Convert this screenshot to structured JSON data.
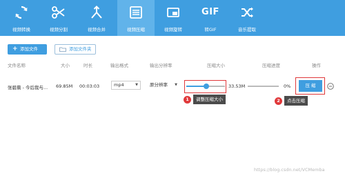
{
  "toolbar": {
    "items": [
      {
        "label": "视频转换",
        "icon": "convert-icon"
      },
      {
        "label": "视频分割",
        "icon": "scissors-icon"
      },
      {
        "label": "视频合并",
        "icon": "merge-icon"
      },
      {
        "label": "视频压缩",
        "icon": "compress-icon"
      },
      {
        "label": "视频旋转",
        "icon": "rotate-icon"
      },
      {
        "label": "转GIF",
        "icon": "gif-icon",
        "glyph": "GIF"
      },
      {
        "label": "音乐提取",
        "icon": "shuffle-icon"
      }
    ],
    "active_index": 3,
    "bg_color": "#3f9ee0"
  },
  "actions": {
    "add_file": "添加文件",
    "add_folder": "添加文件夹"
  },
  "table": {
    "headers": {
      "name": "文件名称",
      "size": "大小",
      "duration": "时长",
      "format": "输出格式",
      "resolution": "输出分辨率",
      "compress_size": "压缩大小",
      "progress": "压缩进度",
      "action": "操作"
    },
    "rows": [
      {
        "name": "张碧晨 - 今后我与...",
        "size": "69.85M",
        "duration": "00:03:03",
        "format": "mp4",
        "resolution": "原分辨率",
        "compress_slider_fraction": 0.52,
        "compress_size": "33.53M",
        "progress_fraction": 0,
        "progress": "0%",
        "button": "压 缩"
      }
    ]
  },
  "annotations": {
    "step1_num": "1",
    "step1_text": "调整压缩大小",
    "step2_num": "2",
    "step2_text": "点击压缩"
  },
  "watermark": "https://blog.csdn.net/VCMemba",
  "colors": {
    "accent": "#3f9ee0",
    "highlight": "#e0383a"
  }
}
